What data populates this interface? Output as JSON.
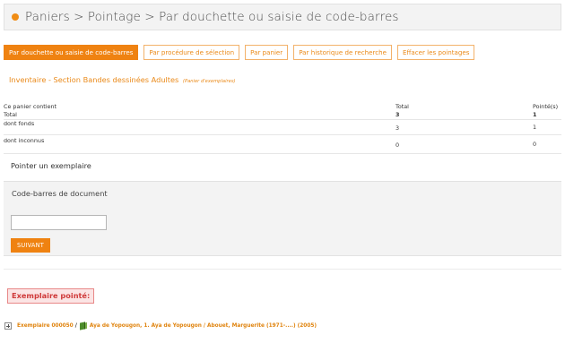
{
  "header": {
    "title": "Paniers > Pointage > Par douchette ou saisie de code-barres",
    "accent_color": "#f08c14"
  },
  "tabs": [
    {
      "label": "Par douchette ou saisie de code-barres",
      "active": true
    },
    {
      "label": "Par procédure de sélection",
      "active": false
    },
    {
      "label": "Par panier",
      "active": false
    },
    {
      "label": "Par historique de recherche",
      "active": false
    },
    {
      "label": "Effacer les pointages",
      "active": false
    }
  ],
  "basket": {
    "title": "Inventaire - Section Bandes dessinées Adultes",
    "subtitle": "(Panier d'exemplaires)"
  },
  "summary": {
    "headers": {
      "label": "Ce panier contient",
      "total": "Total",
      "pointed": "Pointé(s)"
    },
    "rows": [
      {
        "label": "Total",
        "total": "3",
        "pointed": "1"
      },
      {
        "label": "dont fonds",
        "total": "3",
        "pointed": "1"
      },
      {
        "label": "dont inconnus",
        "total": "0",
        "pointed": "0"
      }
    ]
  },
  "pointer": {
    "section_title": "Pointer un exemplaire",
    "field_label": "Code-barres de document",
    "field_value": "",
    "next_button": "SUIVANT"
  },
  "result": {
    "badge": "Exemplaire pointé:",
    "exemplaire": "Exemplaire 000050",
    "slash": "/",
    "notice": "Aya de Yopougon, 1. Aya de Yopougon / Abouet, Marguerite (1971-....) (2005)",
    "icons": {
      "expand": "plus-box-icon",
      "document": "book-icon"
    }
  }
}
